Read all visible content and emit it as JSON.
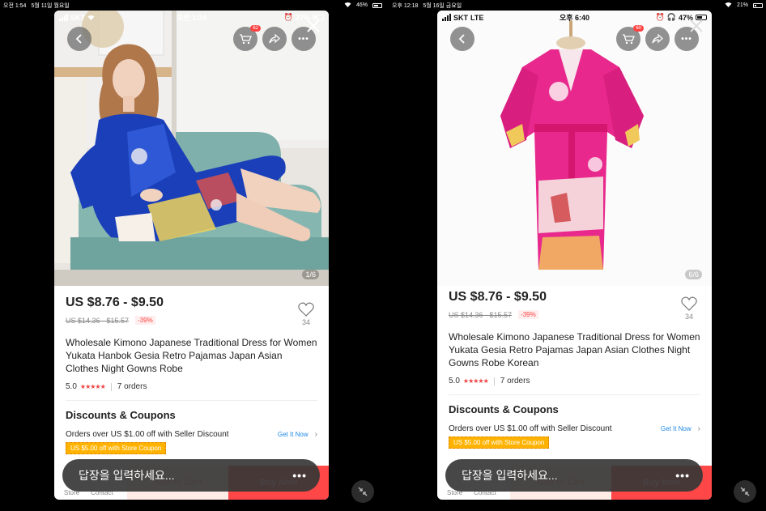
{
  "ipad_status": {
    "left": {
      "time": "오전 1:54",
      "date": "5월 11일 월요일",
      "battery": "46%",
      "battery_fraction": 0.46
    },
    "right": {
      "time": "오후 12:18",
      "date": "5월 16일 금요일",
      "battery": "21%",
      "battery_fraction": 0.21
    }
  },
  "phones": [
    {
      "status": {
        "carrier": "SKT",
        "network": "",
        "time": "오전 1:34",
        "battery": "27%"
      },
      "cart_badge": "62",
      "image_counter": "1/6",
      "image_subject": "woman-in-blue-kimono",
      "price": "US $8.76 - $9.50",
      "old_price": "US $14.36 - $15.57",
      "discount": "-39%",
      "wishlist_count": "34",
      "title": "Wholesale Kimono Japanese Traditional Dress for Women Yukata Hanbok Gesia Retro Pajamas Japan Asian Clothes Night Gowns Robe",
      "rating": "5.0",
      "stars": "★★★★★",
      "orders": "7 orders",
      "section_title": "Discounts & Coupons",
      "seller_discount": "Orders over US $1.00 off with Seller Discount",
      "get_it_now": "Get It Now",
      "store_coupon": "US $5.00 off with Store Coupon",
      "bottom": {
        "store": "Store",
        "contact": "Contact",
        "add_to_cart": "Add to Cart",
        "buy_now": "Buy Now"
      },
      "reply_placeholder": "답장을 입력하세요...",
      "reply_more": "•••"
    },
    {
      "status": {
        "carrier": "SKT",
        "network": "LTE",
        "time": "오후 6:40",
        "battery": "47%"
      },
      "cart_badge": "60",
      "image_counter": "6/6",
      "image_subject": "pink-kimono-on-mannequin",
      "price": "US $8.76 - $9.50",
      "old_price": "US $14.36 - $15.57",
      "discount": "-39%",
      "wishlist_count": "34",
      "title": "Wholesale Kimono Japanese Traditional Dress for Women Yukata Gesia Retro Pajamas Japan Asian Clothes Night Gowns Robe Korean",
      "rating": "5.0",
      "stars": "★★★★★",
      "orders": "7 orders",
      "section_title": "Discounts & Coupons",
      "seller_discount": "Orders over US $1.00 off with Seller Discount",
      "get_it_now": "Get It Now",
      "store_coupon": "US $5.00 off with Store Coupon",
      "bottom": {
        "store": "Store",
        "contact": "Contact",
        "add_to_cart": "Add to Cart",
        "buy_now": "Buy Now"
      },
      "reply_placeholder": "답장을 입력하세요...",
      "reply_more": "•••"
    }
  ],
  "colors": {
    "accent": "#ff4747",
    "link": "#1e88e5",
    "coupon": "#ffb300",
    "kimono_blue": "#1a3fb8",
    "kimono_pink": "#e8288c"
  }
}
